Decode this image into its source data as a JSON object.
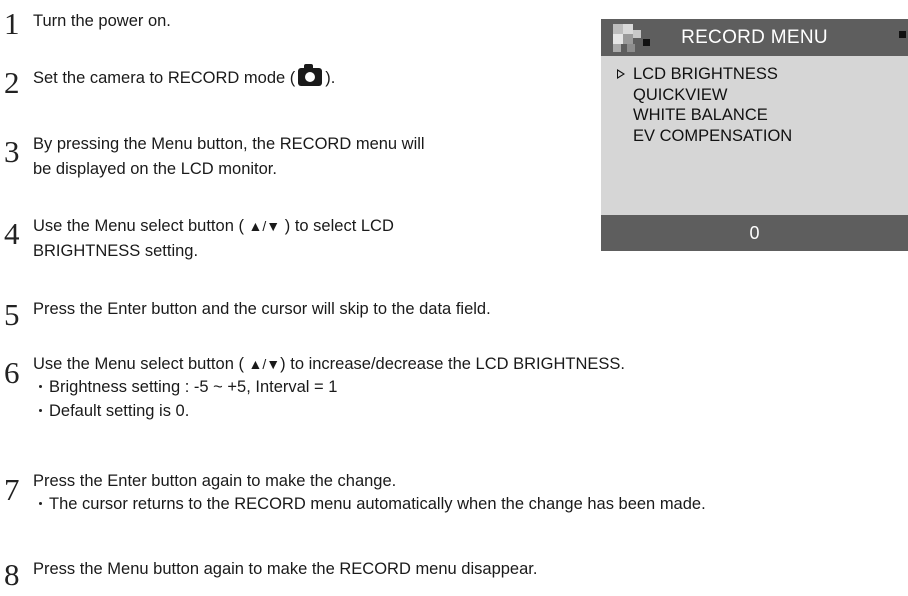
{
  "steps": [
    {
      "number": "1",
      "text": "Turn the power on."
    },
    {
      "number": "2",
      "text_before": "Set the camera to RECORD mode (",
      "icon": "camera-icon",
      "text_after": ")."
    },
    {
      "number": "3",
      "lines": [
        "By pressing the Menu button, the RECORD menu will",
        "be displayed on the LCD monitor."
      ]
    },
    {
      "number": "4",
      "line1_before": "Use the Menu select button (",
      "arrows": "▲/▼",
      "line1_after": ") to select LCD",
      "line2": "BRIGHTNESS setting."
    },
    {
      "number": "5",
      "text": "Press the Enter button and the cursor will skip to the data field."
    },
    {
      "number": "6",
      "text_before": "Use the Menu select button (",
      "arrows": "▲/▼",
      "text_after": ") to increase/decrease the LCD BRIGHTNESS.",
      "notes": [
        "Brightness setting : -5 ~ +5,  Interval = 1",
        "Default setting is 0."
      ]
    },
    {
      "number": "7",
      "text": "Press the Enter button again to make the change.",
      "notes": [
        "The cursor returns to the RECORD menu automatically when the change has been made."
      ]
    },
    {
      "number": "8",
      "text": "Press the Menu button again to make the RECORD menu disappear."
    }
  ],
  "lcd": {
    "title": "RECORD MENU",
    "items": [
      "LCD BRIGHTNESS",
      "QUICKVIEW",
      "WHITE BALANCE",
      "EV COMPENSATION"
    ],
    "selected_index": 0,
    "value": "0",
    "colors": {
      "bar": "#5e5e5e",
      "screen": "#d6d6d6"
    }
  }
}
